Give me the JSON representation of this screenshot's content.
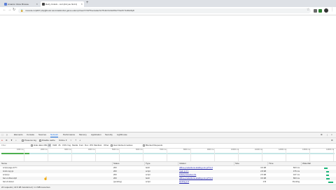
{
  "browser": {
    "tabs": [
      {
        "title": "Amazon Voice Browse"
      },
      {
        "title": "Retry Unlock - curl (did you find it)"
      }
    ],
    "url": "mvcode.ru/p007.php@book.ww.instalsrobot.game.edemp=bee/7r/z0/Therotabe%c7%1b/Vo%20%c7%aYbYbd%20y8"
  },
  "devtools": {
    "tabs": [
      "Elements",
      "Console",
      "Sources",
      "Network",
      "Performance",
      "Memory",
      "Application",
      "Security",
      "Lighthouse"
    ],
    "active_tab": "Network",
    "controls": {
      "preserve_log": "Preserve log",
      "disable_cache": "Disable cache",
      "throttle": "Online"
    },
    "filter": {
      "placeholder": "Filter",
      "hide_data_urls": "Hide data URLs",
      "types": [
        "All",
        "XHR",
        "JS",
        "CSS",
        "Img",
        "Media",
        "Font",
        "Doc",
        "WS",
        "Manifest",
        "Other"
      ],
      "has_blocked": "Has blocked cookies",
      "blocked_requests": "Blocked Requests"
    },
    "timeline_ticks": [
      "1000 ms",
      "2000 ms",
      "3000 ms",
      "4000 ms",
      "5000 ms",
      "6000 ms",
      "7000 ms",
      "8000 ms",
      "9000 ms",
      "10000 ms",
      "11000 ms",
      "12000 ms",
      "13000 ms",
      "14000 ms"
    ],
    "columns": [
      "Name",
      "Status",
      "Type",
      "Initiator",
      "Size",
      "Time",
      "Waterfall"
    ],
    "rows": [
      {
        "name": "script.page.dc?=",
        "status": "200",
        "type": "fetch",
        "initiator": "offline-productions-landing.min.js?=1:0",
        "size": "3.6 kB",
        "time": "823 ms"
      },
      {
        "name": "tmslt.copy.js",
        "status": "200",
        "type": "script",
        "initiator": "main.js:1:1",
        "size": "2.8 kB",
        "time": "476 ms"
      },
      {
        "name": "script.js",
        "status": "200",
        "type": "script",
        "initiator": "initial-production:51",
        "size": "2.5 kB",
        "time": "447 ms"
      },
      {
        "name": "bam-4-fitsut.dph",
        "status": "200",
        "type": "fetch",
        "initiator": "offline-productions-landing.min.js?=1:0",
        "size": "3.6 kB",
        "time": "803 ms"
      },
      {
        "name": "bam-6-fetsut",
        "status": "(pending)",
        "type": "script",
        "initiator": "landing.js:2",
        "size": "0 B",
        "time": "Pending"
      }
    ],
    "status_bar": "24 requests  |  22.6 kB transferred  |  1.1 MB resources"
  },
  "colors": {
    "accent": "#1a73e8",
    "waterfall": "#1db57a"
  }
}
